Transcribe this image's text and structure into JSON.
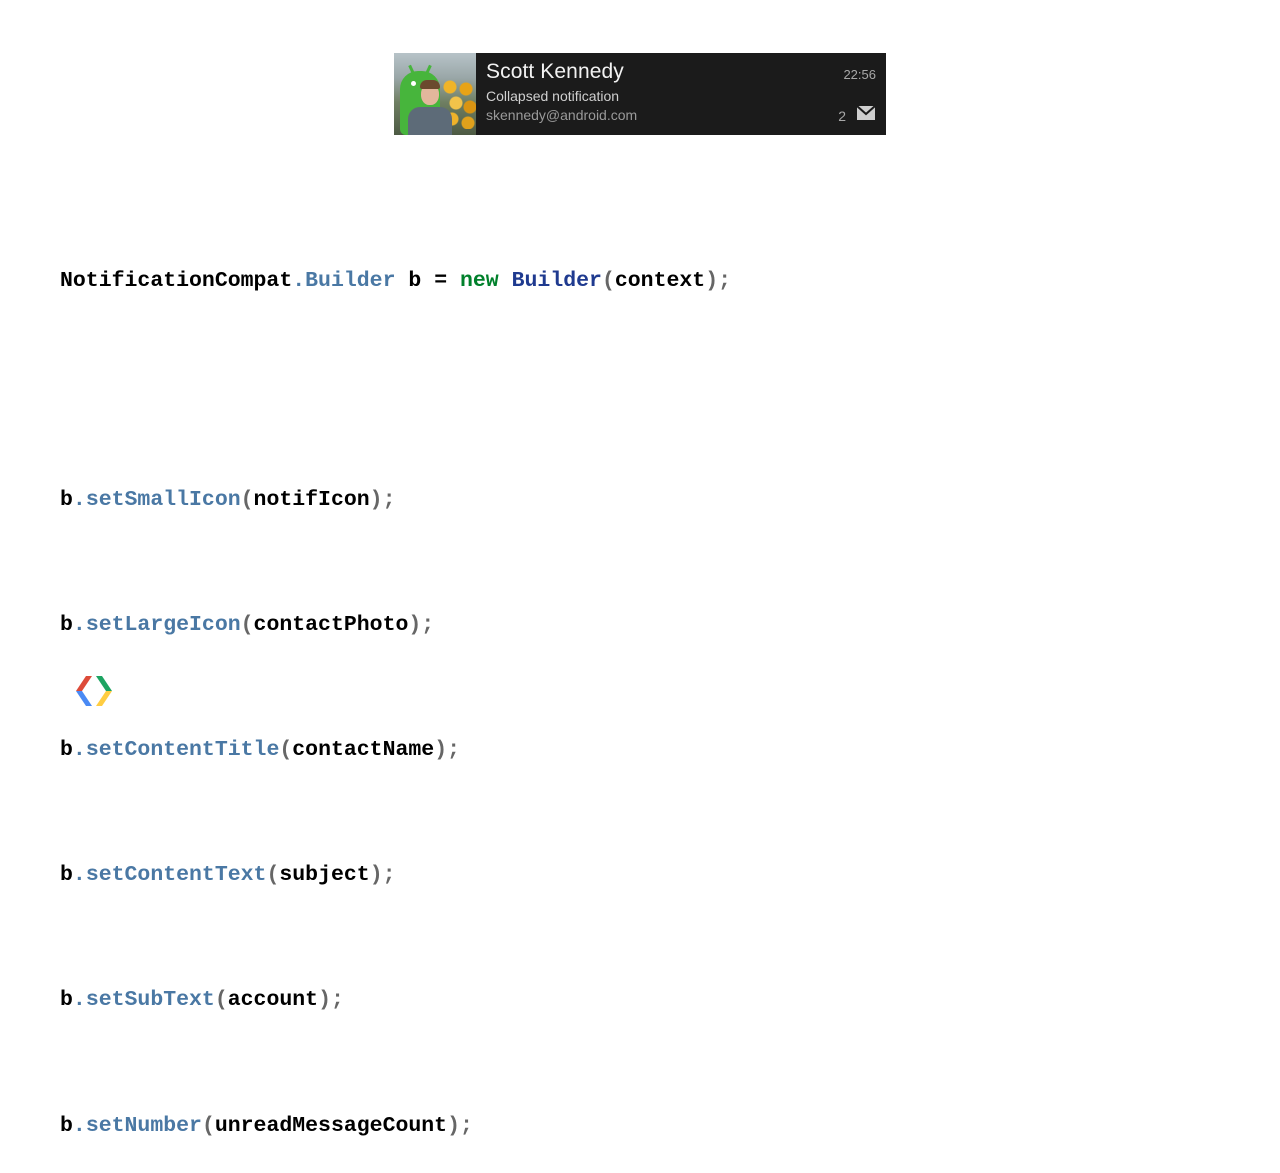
{
  "notification": {
    "title": "Scott Kennedy",
    "text": "Collapsed notification",
    "subtext": "skennedy@android.com",
    "time": "22:56",
    "number": "2",
    "icon": "mail-icon",
    "avatar": "contact-photo"
  },
  "code": {
    "line1": {
      "class_name": "NotificationCompat",
      "dot": ".",
      "builder": "Builder",
      "var_decl": " b = ",
      "keyword": "new",
      "space": " ",
      "type": "Builder",
      "open": "(",
      "arg": "context",
      "close": ")",
      "semi": ";"
    },
    "calls": [
      {
        "receiver": "b",
        "dot": ".",
        "method": "setSmallIcon",
        "open": "(",
        "arg": "notifIcon",
        "close": ")",
        "semi": ";"
      },
      {
        "receiver": "b",
        "dot": ".",
        "method": "setLargeIcon",
        "open": "(",
        "arg": "contactPhoto",
        "close": ")",
        "semi": ";"
      },
      {
        "receiver": "b",
        "dot": ".",
        "method": "setContentTitle",
        "open": "(",
        "arg": "contactName",
        "close": ")",
        "semi": ";"
      },
      {
        "receiver": "b",
        "dot": ".",
        "method": "setContentText",
        "open": "(",
        "arg": "subject",
        "close": ")",
        "semi": ";"
      },
      {
        "receiver": "b",
        "dot": ".",
        "method": "setSubText",
        "open": "(",
        "arg": "account",
        "close": ")",
        "semi": ";"
      },
      {
        "receiver": "b",
        "dot": ".",
        "method": "setNumber",
        "open": "(",
        "arg": "unreadMessageCount",
        "close": ")",
        "semi": ";"
      }
    ]
  },
  "colors": {
    "method": "#4a78a4",
    "keyword": "#00802b",
    "type": "#1f3a8f",
    "notification_bg": "#1b1b1b"
  },
  "logo": "google-developers-logo"
}
